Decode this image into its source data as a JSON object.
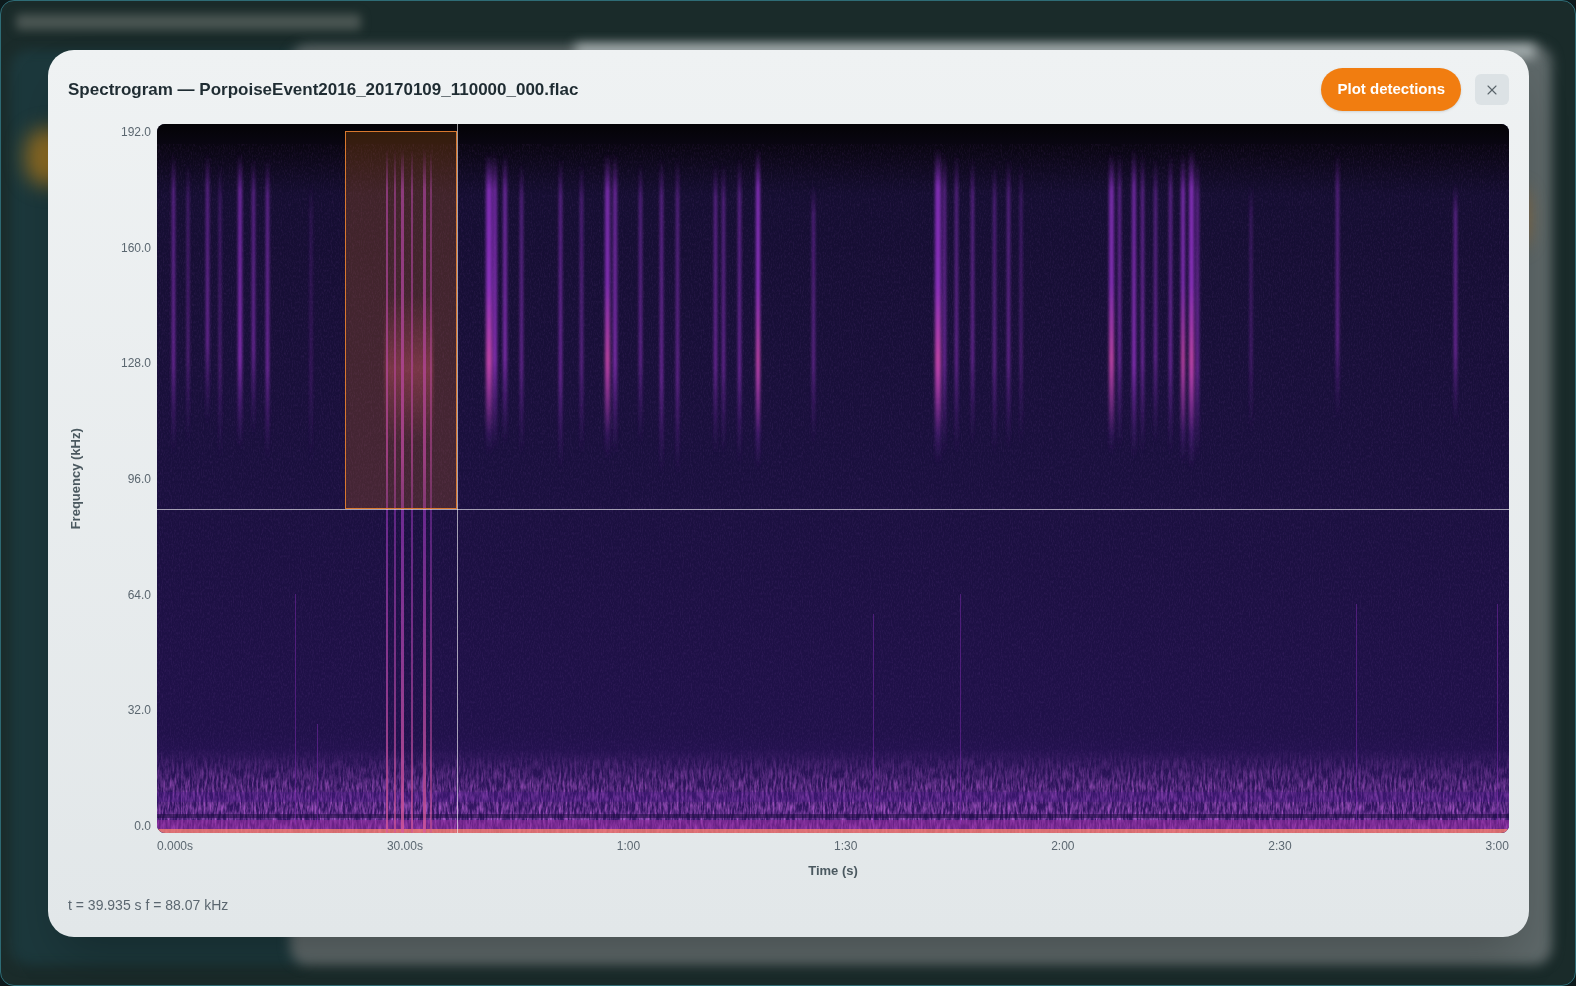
{
  "dialog": {
    "title": "Spectrogram — PorpoiseEvent2016_20170109_110000_000.flac",
    "primary_button": {
      "label": "Plot detections"
    }
  },
  "spectrogram": {
    "ylabel": "Frequency (kHz)",
    "yticks": [
      "192.0",
      "160.0",
      "128.0",
      "96.0",
      "64.0",
      "32.0",
      "0.0"
    ],
    "xticks": [
      "0.000s",
      "30.00s",
      "1:00",
      "1:30",
      "2:00",
      "2:30",
      "3:00"
    ],
    "xlabel": "Time (s)"
  },
  "readout": "t = 39.935 s f = 88.07 kHz"
}
